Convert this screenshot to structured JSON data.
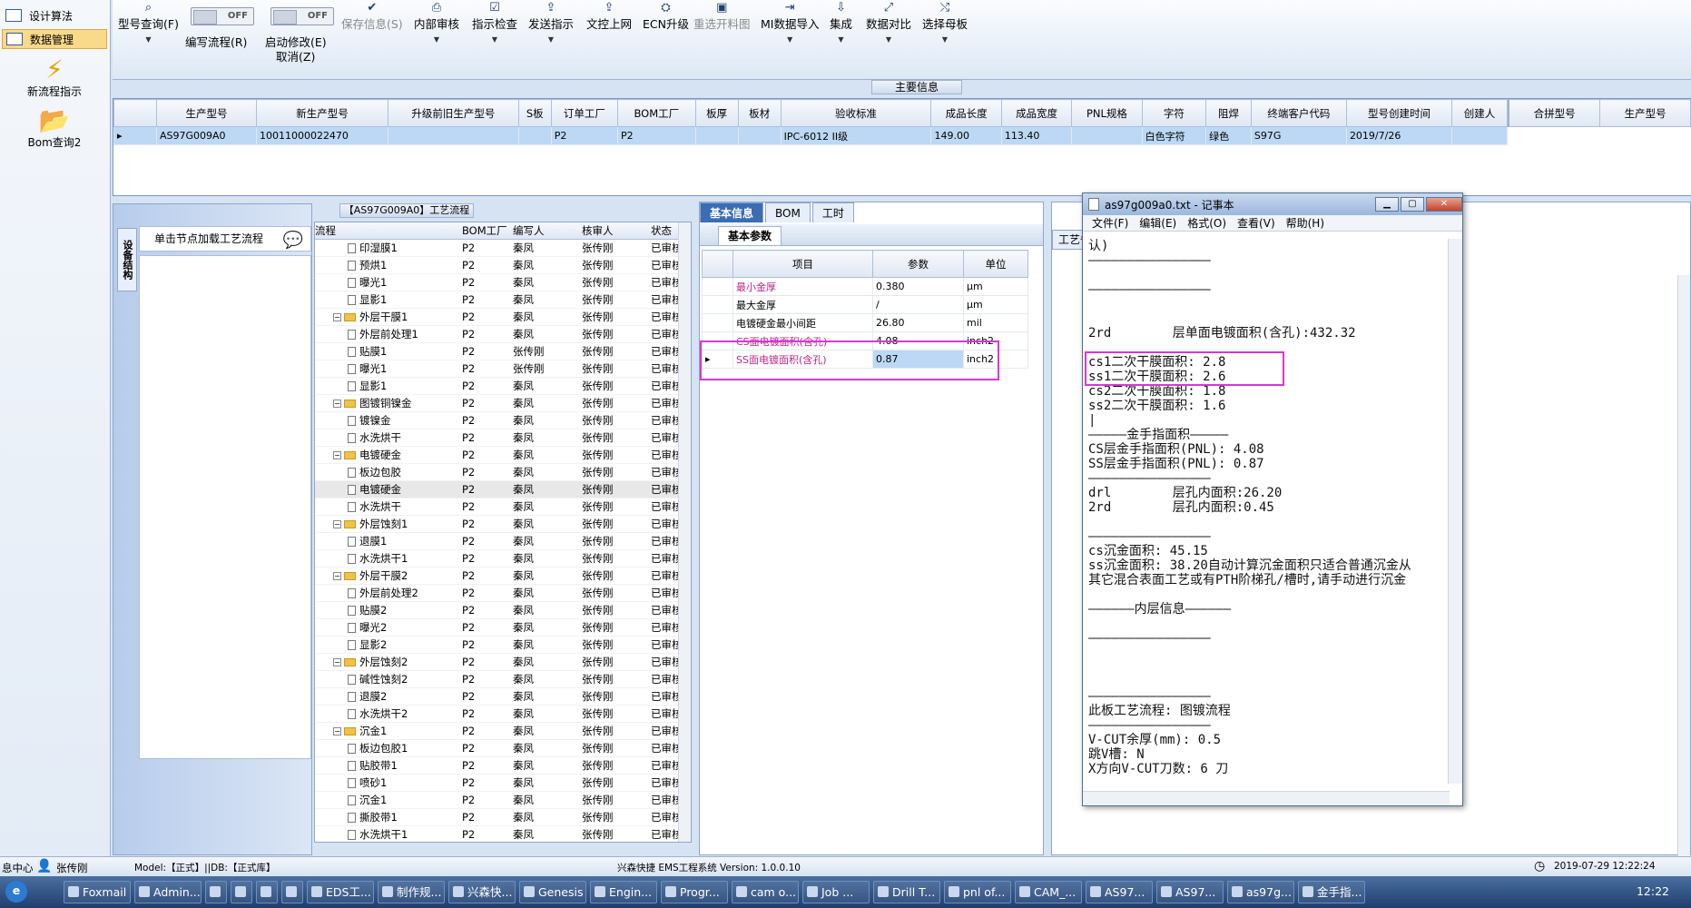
{
  "nav": {
    "items": [
      {
        "label": "设计算法"
      },
      {
        "label": "数据管理"
      }
    ],
    "new_flow": "新流程指示",
    "bom_query": "Bom查询2"
  },
  "toolbar": {
    "buttons": [
      {
        "label": "型号查询(F)",
        "icon": "search-icon"
      },
      {
        "label": "保存信息(S)",
        "icon": "check-icon"
      },
      {
        "label": "内部审核",
        "icon": "print-icon"
      },
      {
        "label": "指示检查",
        "icon": "check-icon"
      },
      {
        "label": "发送指示",
        "icon": "upload-icon"
      },
      {
        "label": "文控上网",
        "icon": "upload-icon"
      },
      {
        "label": "ECN升级",
        "icon": "ecn-icon"
      },
      {
        "label": "重选开料图",
        "icon": "image-icon"
      },
      {
        "label": "MI数据导入",
        "icon": "import-icon"
      },
      {
        "label": "集成",
        "icon": "download-icon"
      },
      {
        "label": "数据对比",
        "icon": "compare-icon"
      },
      {
        "label": "选择母板",
        "icon": "shuffle-icon"
      }
    ],
    "toggle_off": "OFF",
    "write_flow": "编写流程(R)",
    "enable_modify": "启动修改(E)",
    "cancel": "取消(Z)"
  },
  "main_info": {
    "title": "主要信息",
    "columns": [
      "生产型号",
      "新生产型号",
      "升级前旧生产型号",
      "S板",
      "订单工厂",
      "BOM工厂",
      "板厚",
      "板材",
      "验收标准",
      "成品长度",
      "成品宽度",
      "PNL规格",
      "字符",
      "阻焊",
      "终端客户代码",
      "型号创建时间",
      "创建人"
    ],
    "row": [
      "AS97G009A0",
      "10011000022470",
      "",
      "",
      "P2",
      "P2",
      "",
      "",
      "IPC-6012 II级",
      "149.00",
      "113.40",
      "",
      "白色字符",
      "绿色",
      "S97G",
      "2019/7/26",
      ""
    ],
    "side_columns": [
      "合拼型号",
      "生产型号"
    ]
  },
  "left_panel": {
    "vtab": "设备结构",
    "caption": "单击节点加载工艺流程"
  },
  "flow_panel": {
    "title": "【AS97G009A0】工艺流程",
    "columns": [
      "流程",
      "BOM工厂",
      "编写人",
      "核审人",
      "状态"
    ],
    "rows": [
      {
        "name": "印湿膜1",
        "t": "doc",
        "f": "P2",
        "w": "秦凤",
        "r": "张传刚",
        "s": "已审核"
      },
      {
        "name": "预烘1",
        "t": "doc",
        "f": "P2",
        "w": "秦凤",
        "r": "张传刚",
        "s": "已审核"
      },
      {
        "name": "曝光1",
        "t": "doc",
        "f": "P2",
        "w": "秦凤",
        "r": "张传刚",
        "s": "已审核"
      },
      {
        "name": "显影1",
        "t": "doc",
        "f": "P2",
        "w": "秦凤",
        "r": "张传刚",
        "s": "已审核"
      },
      {
        "name": "外层干膜1",
        "t": "fold",
        "f": "P2",
        "w": "秦凤",
        "r": "张传刚",
        "s": "已审核"
      },
      {
        "name": "外层前处理1",
        "t": "doc",
        "f": "P2",
        "w": "秦凤",
        "r": "张传刚",
        "s": "已审核"
      },
      {
        "name": "贴膜1",
        "t": "doc",
        "f": "P2",
        "w": "张传刚",
        "r": "张传刚",
        "s": "已审核"
      },
      {
        "name": "曝光1",
        "t": "doc",
        "f": "P2",
        "w": "张传刚",
        "r": "张传刚",
        "s": "已审核"
      },
      {
        "name": "显影1",
        "t": "doc",
        "f": "P2",
        "w": "秦凤",
        "r": "张传刚",
        "s": "已审核"
      },
      {
        "name": "图镀铜镍金",
        "t": "fold",
        "f": "P2",
        "w": "秦凤",
        "r": "张传刚",
        "s": "已审核"
      },
      {
        "name": "镀镍金",
        "t": "doc",
        "f": "P2",
        "w": "秦凤",
        "r": "张传刚",
        "s": "已审核"
      },
      {
        "name": "水洗烘干",
        "t": "doc",
        "f": "P2",
        "w": "秦凤",
        "r": "张传刚",
        "s": "已审核"
      },
      {
        "name": "电镀硬金",
        "t": "fold",
        "f": "P2",
        "w": "秦凤",
        "r": "张传刚",
        "s": "已审核"
      },
      {
        "name": "板边包胶",
        "t": "doc",
        "f": "P2",
        "w": "秦凤",
        "r": "张传刚",
        "s": "已审核"
      },
      {
        "name": "电镀硬金",
        "t": "doc",
        "f": "P2",
        "w": "秦凤",
        "r": "张传刚",
        "s": "已审核"
      },
      {
        "name": "水洗烘干",
        "t": "doc",
        "f": "P2",
        "w": "秦凤",
        "r": "张传刚",
        "s": "已审核"
      },
      {
        "name": "外层蚀刻1",
        "t": "fold",
        "f": "P2",
        "w": "秦凤",
        "r": "张传刚",
        "s": "已审核"
      },
      {
        "name": "退膜1",
        "t": "doc",
        "f": "P2",
        "w": "秦凤",
        "r": "张传刚",
        "s": "已审核"
      },
      {
        "name": "水洗烘干1",
        "t": "doc",
        "f": "P2",
        "w": "秦凤",
        "r": "张传刚",
        "s": "已审核"
      },
      {
        "name": "外层干膜2",
        "t": "fold",
        "f": "P2",
        "w": "秦凤",
        "r": "张传刚",
        "s": "已审核"
      },
      {
        "name": "外层前处理2",
        "t": "doc",
        "f": "P2",
        "w": "秦凤",
        "r": "张传刚",
        "s": "已审核"
      },
      {
        "name": "贴膜2",
        "t": "doc",
        "f": "P2",
        "w": "秦凤",
        "r": "张传刚",
        "s": "已审核"
      },
      {
        "name": "曝光2",
        "t": "doc",
        "f": "P2",
        "w": "秦凤",
        "r": "张传刚",
        "s": "已审核"
      },
      {
        "name": "显影2",
        "t": "doc",
        "f": "P2",
        "w": "秦凤",
        "r": "张传刚",
        "s": "已审核"
      },
      {
        "name": "外层蚀刻2",
        "t": "fold",
        "f": "P2",
        "w": "秦凤",
        "r": "张传刚",
        "s": "已审核"
      },
      {
        "name": "碱性蚀刻2",
        "t": "doc",
        "f": "P2",
        "w": "秦凤",
        "r": "张传刚",
        "s": "已审核"
      },
      {
        "name": "退膜2",
        "t": "doc",
        "f": "P2",
        "w": "秦凤",
        "r": "张传刚",
        "s": "已审核"
      },
      {
        "name": "水洗烘干2",
        "t": "doc",
        "f": "P2",
        "w": "秦凤",
        "r": "张传刚",
        "s": "已审核"
      },
      {
        "name": "沉金1",
        "t": "fold",
        "f": "P2",
        "w": "秦凤",
        "r": "张传刚",
        "s": "已审核"
      },
      {
        "name": "板边包胶1",
        "t": "doc",
        "f": "P2",
        "w": "秦凤",
        "r": "张传刚",
        "s": "已审核"
      },
      {
        "name": "贴胶带1",
        "t": "doc",
        "f": "P2",
        "w": "秦凤",
        "r": "张传刚",
        "s": "已审核"
      },
      {
        "name": "喷砂1",
        "t": "doc",
        "f": "P2",
        "w": "秦凤",
        "r": "张传刚",
        "s": "已审核"
      },
      {
        "name": "沉金1",
        "t": "doc",
        "f": "P2",
        "w": "秦凤",
        "r": "张传刚",
        "s": "已审核"
      },
      {
        "name": "撕胶带1",
        "t": "doc",
        "f": "P2",
        "w": "秦凤",
        "r": "张传刚",
        "s": "已审核"
      },
      {
        "name": "水洗烘干1",
        "t": "doc",
        "f": "P2",
        "w": "秦凤",
        "r": "张传刚",
        "s": "已审核"
      }
    ]
  },
  "info_panel": {
    "tabs": [
      "基本信息",
      "BOM",
      "工时"
    ],
    "subtab": "基本参数",
    "columns": [
      "项目",
      "参数",
      "单位"
    ],
    "rows": [
      {
        "item": "最小金厚",
        "value": "0.380",
        "unit": "μm",
        "pink": true
      },
      {
        "item": "最大金厚",
        "value": "/",
        "unit": "μm",
        "pink": false
      },
      {
        "item": "电镀硬金最小间距",
        "value": "26.80",
        "unit": "mil",
        "pink": false
      },
      {
        "item": "CS面电镀面积(含孔)",
        "value": "4.08",
        "unit": "inch2",
        "pink": true
      },
      {
        "item": "SS面电镀面积(含孔)",
        "value": "0.87",
        "unit": "inch2",
        "pink": true
      }
    ],
    "right_tab": "工艺备"
  },
  "notepad": {
    "title": "as97g009a0.txt - 记事本",
    "menu": [
      "文件(F)",
      "编辑(E)",
      "格式(O)",
      "查看(V)",
      "帮助(H)"
    ],
    "lines": [
      "认)",
      "————————————————",
      "",
      "————————————————",
      "",
      "",
      "2rd        层单面电镀面积(含孔):432.32",
      "",
      "cs1二次干膜面积: 2.8",
      "ss1二次干膜面积: 2.6",
      "cs2二次干膜面积: 1.8",
      "ss2二次干膜面积: 1.6",
      "|",
      "—————金手指面积—————",
      "CS层金手指面积(PNL): 4.08",
      "SS层金手指面积(PNL): 0.87",
      "————————————————",
      "drl        层孔内面积:26.20",
      "2rd        层孔内面积:0.45",
      "",
      "————————————————",
      "cs沉金面积: 45.15",
      "ss沉金面积: 38.20自动计算沉金面积只适合普通沉金从",
      "其它混合表面工艺或有PTH阶梯孔/槽时,请手动进行沉金",
      "",
      "——————内层信息——————",
      "",
      "————————————————",
      "",
      "",
      "",
      "————————————————",
      "此板工艺流程: 图镀流程",
      "————————————————",
      "V-CUT余厚(mm): 0.5",
      "跳V槽: N",
      "X方向V-CUT刀数: 6 刀"
    ]
  },
  "status": {
    "left": "息中心",
    "user": "张传刚",
    "model": "Model:【正式】||DB:【正式库】",
    "app": "兴森快捷 EMS工程系统 Version: 1.0.0.10",
    "time": "2019-07-29 12:22:24"
  },
  "taskbar": {
    "items": [
      "Foxmail",
      "Admin...",
      "",
      "",
      "",
      "",
      "EDS工...",
      "制作规...",
      "兴森快...",
      "Genesis",
      "Engin...",
      "Progr...",
      "cam o...",
      "Job ...",
      "Drill T...",
      "pnl of...",
      "CAM_...",
      "AS97...",
      "AS97...",
      "as97g...",
      "金手指..."
    ],
    "clock": "12:22"
  }
}
